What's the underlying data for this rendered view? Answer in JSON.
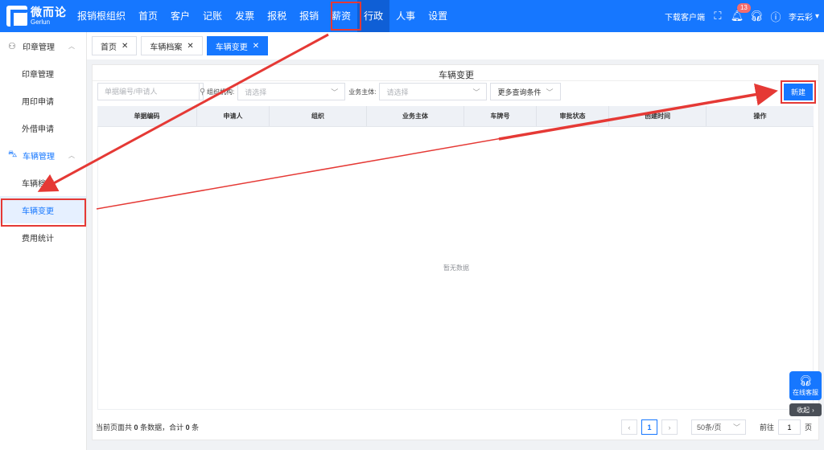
{
  "brand": {
    "name_cn": "微而论",
    "name_en": "Gerlun"
  },
  "nav": [
    {
      "label": "报销根组织"
    },
    {
      "label": "首页"
    },
    {
      "label": "客户"
    },
    {
      "label": "记账"
    },
    {
      "label": "发票"
    },
    {
      "label": "报税"
    },
    {
      "label": "报销"
    },
    {
      "label": "薪资"
    },
    {
      "label": "行政",
      "active": true
    },
    {
      "label": "人事"
    },
    {
      "label": "设置"
    }
  ],
  "top_right": {
    "download_label": "下载客户端",
    "notification_count": "13",
    "user_name": "李云彩"
  },
  "sidebar": {
    "groups": [
      {
        "label": "印章管理",
        "icon": "user-icon",
        "items": [
          {
            "label": "印章管理"
          },
          {
            "label": "用印申请"
          },
          {
            "label": "外借申请"
          }
        ]
      },
      {
        "label": "车辆管理",
        "icon": "car-icon",
        "items": [
          {
            "label": "车辆档案"
          },
          {
            "label": "车辆变更",
            "active": true
          },
          {
            "label": "费用统计"
          }
        ]
      }
    ]
  },
  "tabs": [
    {
      "label": "首页"
    },
    {
      "label": "车辆档案"
    },
    {
      "label": "车辆变更",
      "active": true
    }
  ],
  "page": {
    "title": "车辆变更",
    "search_placeholder": "单据编号/申请人",
    "org_label": "组织机构:",
    "org_placeholder": "请选择",
    "entity_label": "业务主体:",
    "entity_placeholder": "请选择",
    "more_conditions": "更多查询条件",
    "new_button": "新建"
  },
  "table": {
    "columns": [
      "单据编码",
      "申请人",
      "组织",
      "业务主体",
      "车牌号",
      "审批状态",
      "创建时间",
      "操作"
    ],
    "rows": [],
    "empty_text": "暂无数据"
  },
  "footer": {
    "summary_prefix": "当前页面共",
    "summary_count": "0",
    "summary_mid": "条数据，合计",
    "summary_total": "0",
    "summary_suffix": "条",
    "current_page": "1",
    "page_size": "50条/页",
    "goto_label": "前往",
    "goto_value": "1",
    "page_unit": "页"
  },
  "widget": {
    "service_label": "在线客服",
    "collapse_label": "收起"
  },
  "colors": {
    "primary": "#1677ff",
    "annotation": "#e53935"
  }
}
